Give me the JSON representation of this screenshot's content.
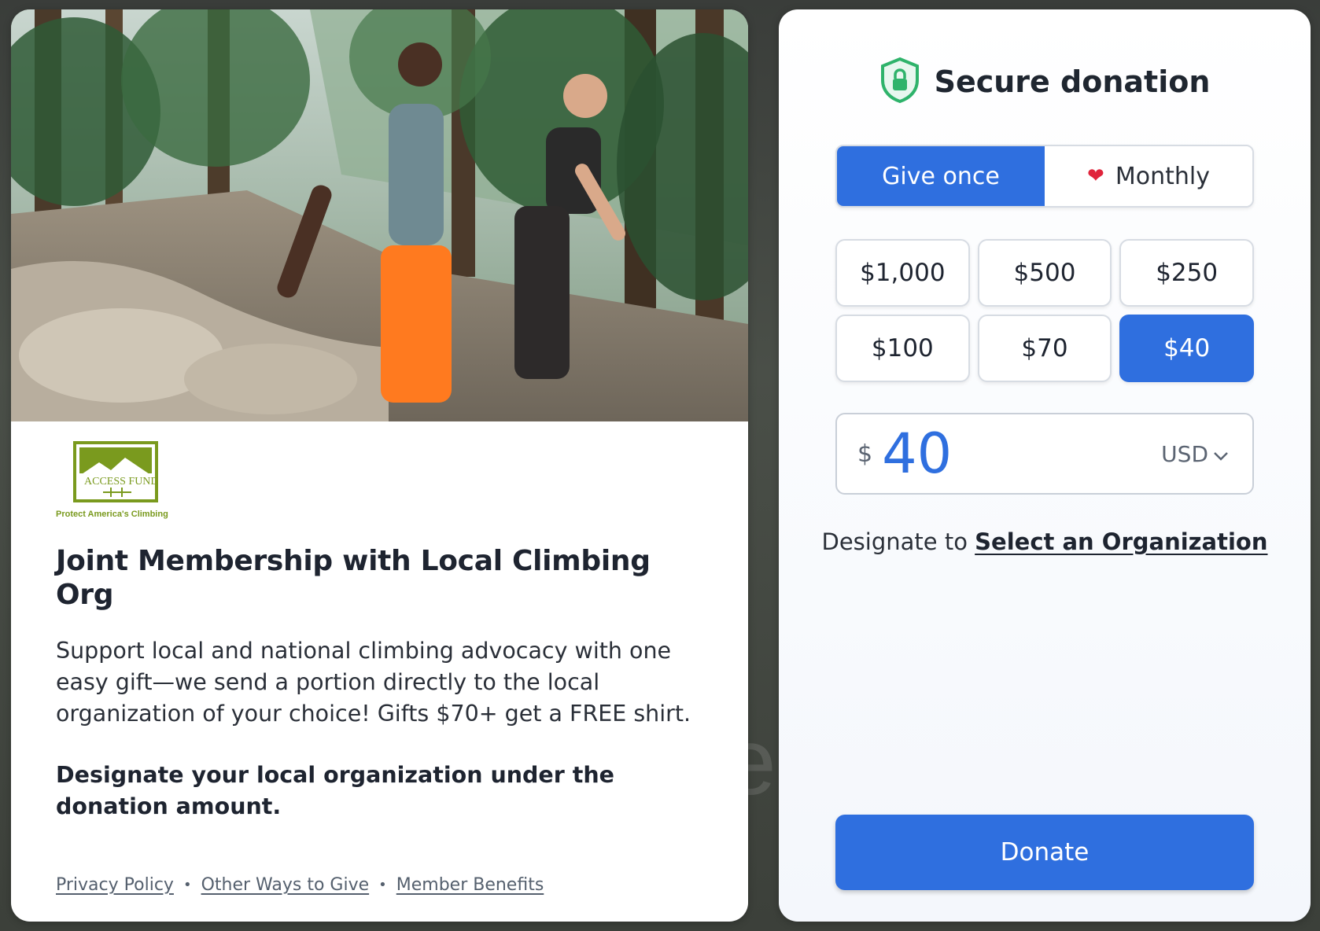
{
  "campaign": {
    "logo_text": "ACCESS FUND",
    "logo_tagline": "Protect America's Climbing",
    "title": "Joint Membership with Local Climbing Org",
    "description": "Support local and national climbing advocacy with one easy gift—we send a portion directly to the local organization of your choice! Gifts $70+ get a FREE shirt.",
    "note": "Designate your local organization under the donation amount."
  },
  "footer": {
    "links": [
      "Privacy Policy",
      "Other Ways to Give",
      "Member Benefits"
    ]
  },
  "donation": {
    "header": "Secure donation",
    "frequency": {
      "once": "Give once",
      "monthly": "Monthly",
      "selected": "once"
    },
    "amounts": [
      "$1,000",
      "$500",
      "$250",
      "$100",
      "$70",
      "$40"
    ],
    "selected_amount": "$40",
    "input": {
      "currency_symbol": "$",
      "value": "40",
      "currency": "USD"
    },
    "designate_prefix": "Designate to",
    "designate_link": "Select an Organization",
    "submit": "Donate"
  },
  "colors": {
    "accent": "#2f6fdf",
    "shield": "#2fb36b",
    "heart": "#e0243b",
    "logo_green": "#7a9a1e"
  },
  "icons": {
    "shield": "shield-lock-icon",
    "heart": "heart-icon",
    "chevron": "chevron-down-icon"
  }
}
